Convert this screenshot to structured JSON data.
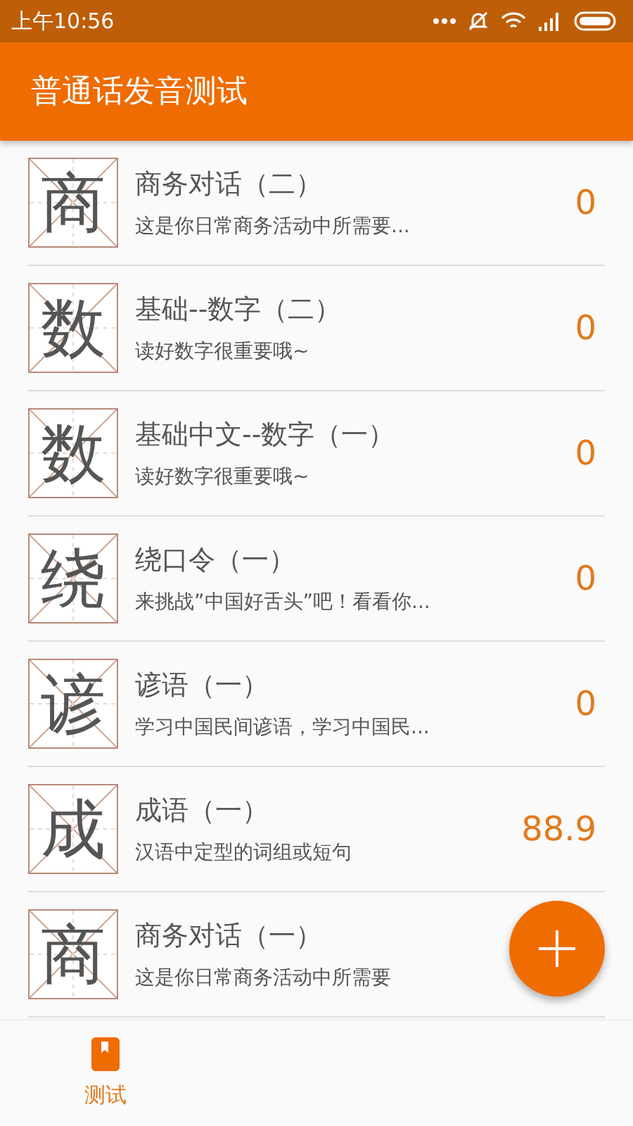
{
  "status_bar": {
    "time": "上午10:56"
  },
  "app_bar": {
    "title": "普通话发音测试"
  },
  "lessons": [
    {
      "character": "商",
      "title": "商务对话（二）",
      "subtitle": "这是你日常商务活动中所需要...",
      "score": "0"
    },
    {
      "character": "数",
      "title": "基础--数字（二）",
      "subtitle": "读好数字很重要哦~",
      "score": "0"
    },
    {
      "character": "数",
      "title": "基础中文--数字（一）",
      "subtitle": "读好数字很重要哦~",
      "score": "0"
    },
    {
      "character": "绕",
      "title": "绕口令（一）",
      "subtitle": "来挑战”中国好舌头”吧！看看你...",
      "score": "0"
    },
    {
      "character": "谚",
      "title": "谚语（一）",
      "subtitle": "学习中国民间谚语，学习中国民...",
      "score": "0"
    },
    {
      "character": "成",
      "title": "成语（一）",
      "subtitle": "汉语中定型的词组或短句",
      "score": "88.9"
    },
    {
      "character": "商",
      "title": "商务对话（一）",
      "subtitle": "这是你日常商务活动中所需要"
    }
  ],
  "bottom_nav": [
    {
      "label": "测试",
      "selected": true
    }
  ]
}
